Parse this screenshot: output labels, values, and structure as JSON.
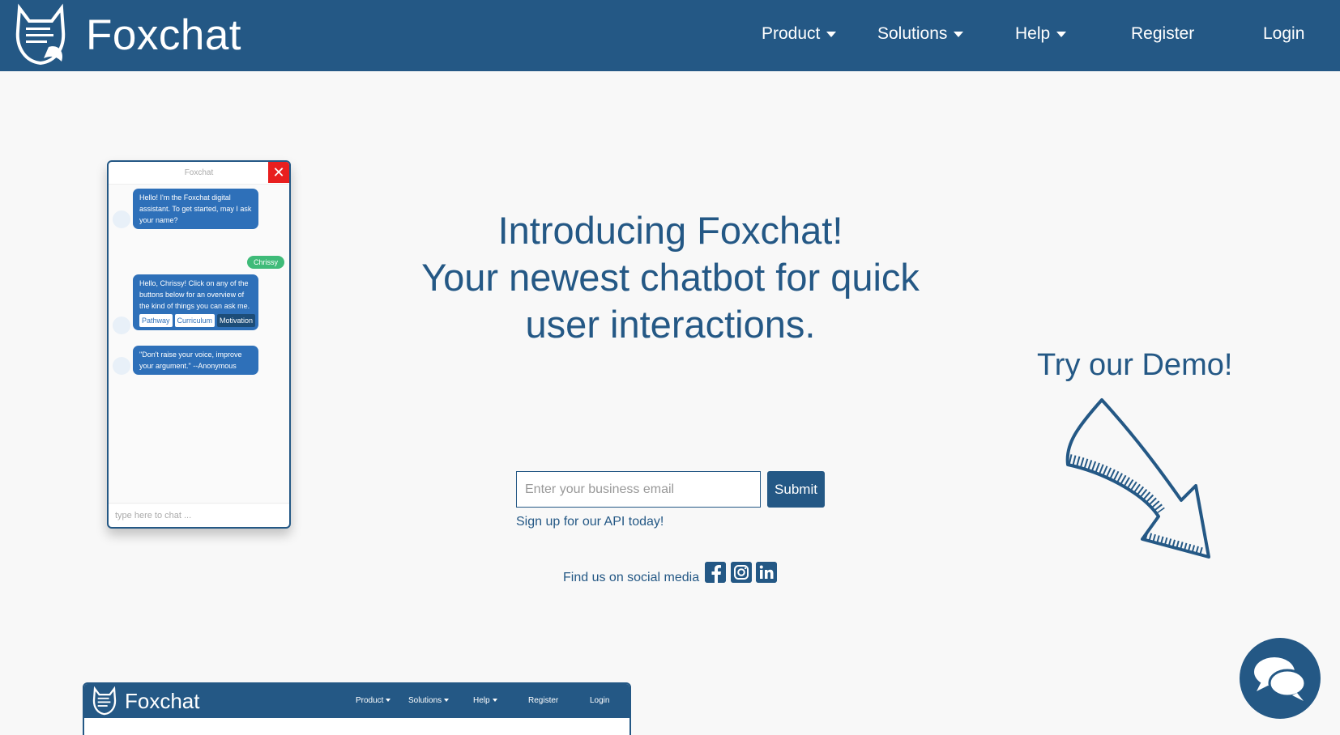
{
  "brand": {
    "name": "Foxchat"
  },
  "nav": {
    "product": "Product",
    "solutions": "Solutions",
    "help": "Help",
    "register": "Register",
    "login": "Login"
  },
  "chat_preview": {
    "title": "Foxchat",
    "close_icon": "close-icon",
    "msg1": "Hello! I'm the Foxchat digital assistant. To get started, may I ask your name?",
    "user_reply": "Chrissy",
    "msg2": "Hello, Chrissy! Click on any of the buttons below for an overview of the kind of things you can ask me.",
    "chips": [
      "Pathway",
      "Curriculum",
      "Motivation"
    ],
    "msg3": "\"Don't raise your voice, improve your argument.\" --Anonymous",
    "input_placeholder": "type here to chat ..."
  },
  "hero": {
    "line1": "Introducing Foxchat!",
    "line2": "Your newest chatbot for quick",
    "line3": "user interactions."
  },
  "demo": {
    "title": "Try our Demo!"
  },
  "signup": {
    "email_placeholder": "Enter your business email",
    "submit_label": "Submit",
    "caption": "Sign up for our API today!"
  },
  "social": {
    "label": "Find us on social media",
    "icons": [
      "facebook-icon",
      "instagram-icon",
      "linkedin-icon"
    ]
  },
  "bottom_preview": {
    "brand": "Foxchat",
    "nav": [
      "Product",
      "Solutions",
      "Help",
      "Register",
      "Login"
    ]
  },
  "colors": {
    "primary": "#245885",
    "bot_bubble": "#2e70b9",
    "user_bubble": "#3fbb79",
    "close": "#e81f1f",
    "background": "#f8f8f8"
  }
}
